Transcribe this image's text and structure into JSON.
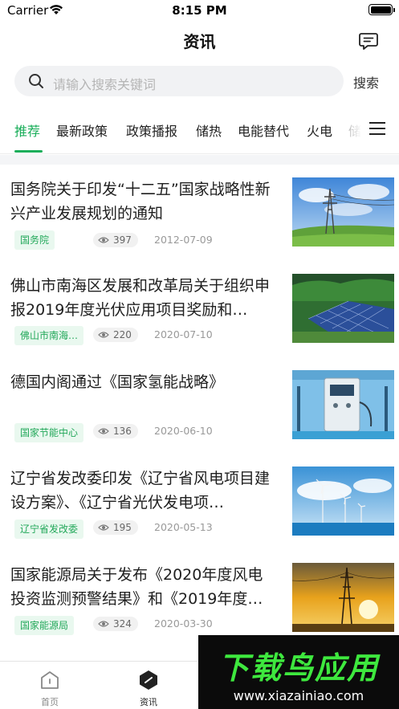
{
  "status_bar": {
    "carrier": "Carrier",
    "time": "8:15 PM"
  },
  "header": {
    "title": "资讯",
    "message_icon": "message-icon"
  },
  "search": {
    "placeholder": "请输入搜索关键词",
    "button_label": "搜索",
    "icon": "search-icon"
  },
  "tabs": [
    "推荐",
    "最新政策",
    "政策播报",
    "储热",
    "电能替代",
    "火电",
    "储"
  ],
  "active_tab": "推荐",
  "articles": [
    {
      "title": "国务院关于印发“十二五”国家战略性新兴产业发展规划的通知",
      "source": "国务院",
      "views": "397",
      "date": "2012-07-09",
      "thumb": "power-tower-field"
    },
    {
      "title": "佛山市南海区发展和改革局关于组织申报2019年度光伏应用项目奖励和…",
      "source": "佛山市南海…",
      "views": "220",
      "date": "2020-07-10",
      "thumb": "solar-panels"
    },
    {
      "title": "德国内阁通过《国家氢能战略》",
      "source": "国家节能中心",
      "views": "136",
      "date": "2020-06-10",
      "thumb": "hydrogen-station"
    },
    {
      "title": "辽宁省发改委印发《辽宁省风电项目建设方案》、《辽宁省光伏发电项…",
      "source": "辽宁省发改委",
      "views": "195",
      "date": "2020-05-13",
      "thumb": "wind-turbines"
    },
    {
      "title": "国家能源局关于发布《2020年度风电投资监测预警结果》和《2019年度…",
      "source": "国家能源局",
      "views": "324",
      "date": "2020-03-30",
      "thumb": "sunset-tower"
    }
  ],
  "tabbar": [
    {
      "label": "首页",
      "icon": "home-icon",
      "active": false
    },
    {
      "label": "资讯",
      "icon": "news-icon",
      "active": true
    }
  ],
  "watermark": {
    "logo_text": "下载鸟应用",
    "url": "www.xiazainiao.com"
  },
  "colors": {
    "accent": "#1aae5a",
    "source_bg": "#e9f8ef"
  }
}
